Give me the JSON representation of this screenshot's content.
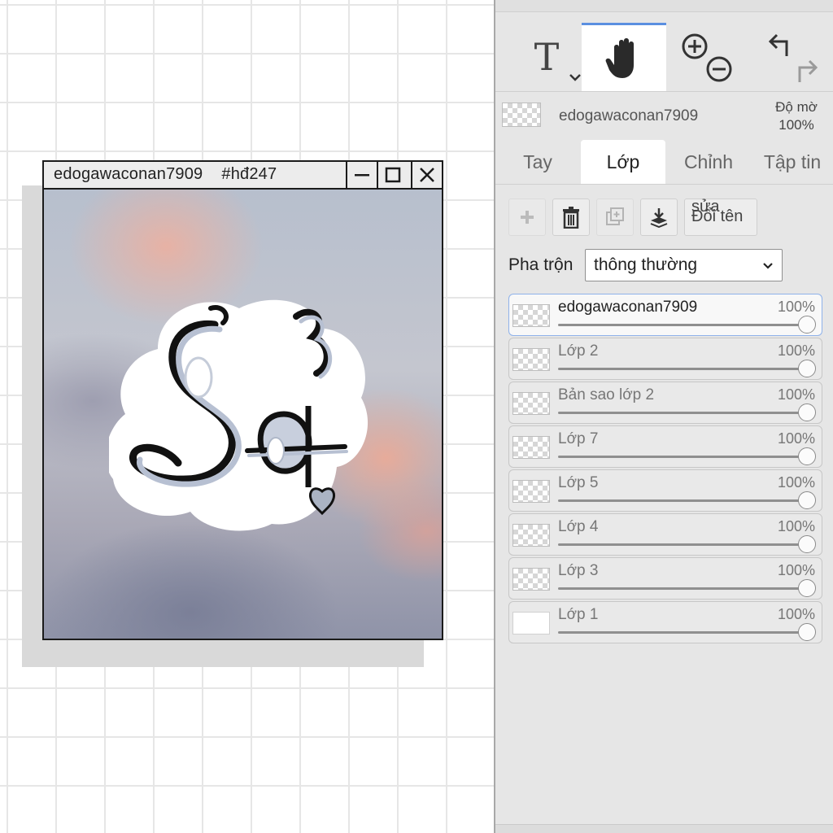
{
  "window": {
    "title": "edogawaconan7909    #hđ247"
  },
  "toolbar": {
    "tools": [
      {
        "name": "text-tool",
        "label": "T",
        "active": false
      },
      {
        "name": "hand-tool",
        "active": true
      },
      {
        "name": "zoom",
        "active": false
      },
      {
        "name": "history",
        "active": false
      }
    ]
  },
  "layer_info": {
    "name": "edogawaconan7909",
    "opacity_label": "Độ mờ",
    "opacity_value": "100%"
  },
  "tabs": [
    {
      "label": "Tay",
      "active": false
    },
    {
      "label": "Lớp",
      "active": true
    },
    {
      "label": "Chỉnh",
      "active": false
    },
    {
      "label": "Tập tin",
      "active": false
    }
  ],
  "actions": {
    "rename_top": "sửa",
    "rename_label": "Đổi tên"
  },
  "blend": {
    "label": "Pha trộn",
    "value": "thông thường"
  },
  "layers": [
    {
      "name": "edogawaconan7909",
      "opacity": "100%",
      "active": true
    },
    {
      "name": "Lớp 2",
      "opacity": "100%",
      "active": false
    },
    {
      "name": "Bản sao lớp 2",
      "opacity": "100%",
      "active": false
    },
    {
      "name": "Lớp 7",
      "opacity": "100%",
      "active": false
    },
    {
      "name": "Lớp 5",
      "opacity": "100%",
      "active": false
    },
    {
      "name": "Lớp 4",
      "opacity": "100%",
      "active": false
    },
    {
      "name": "Lớp 3",
      "opacity": "100%",
      "active": false
    },
    {
      "name": "Lớp 1",
      "opacity": "100%",
      "active": false
    }
  ],
  "colors": {
    "accent": "#5b8fe0",
    "panel_bg": "#e6e6e6",
    "grid": "#e6e6e6"
  }
}
